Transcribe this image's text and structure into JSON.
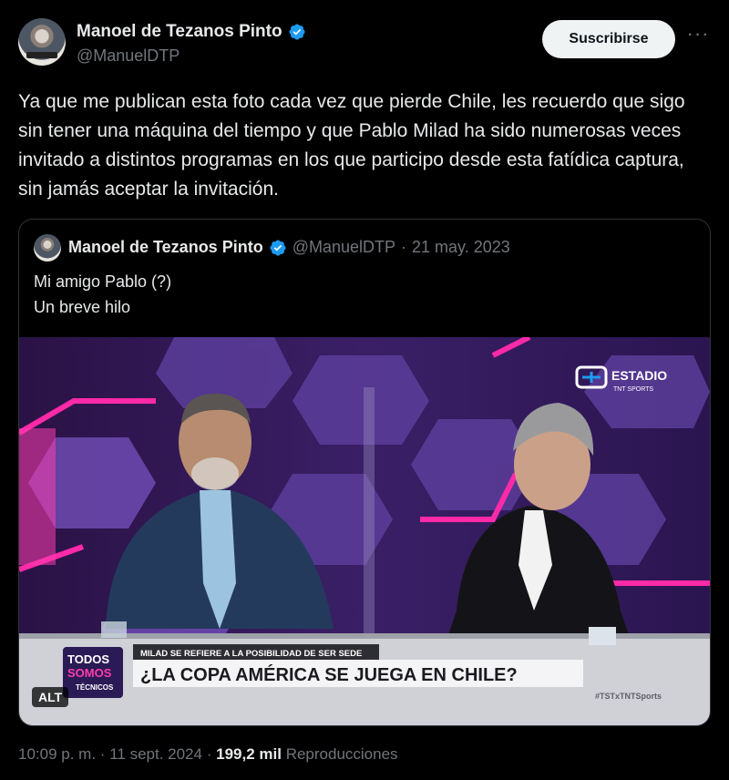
{
  "author": {
    "name": "Manoel de Tezanos Pinto",
    "handle": "@ManuelDTP"
  },
  "actions": {
    "subscribe_label": "Suscribirse",
    "more_label": "···"
  },
  "tweet": {
    "text": "Ya que me publican esta foto cada vez que pierde Chile, les recuerdo que sigo sin tener una máquina del tiempo y que Pablo Milad ha sido numerosas veces invitado a distintos programas en los que participo desde esta fatídica captura, sin jamás aceptar la invitación."
  },
  "quoted": {
    "name": "Manoel de Tezanos Pinto",
    "handle": "@ManuelDTP",
    "separator": "·",
    "date": "21 may. 2023",
    "text_line1": "Mi amigo Pablo (?)",
    "text_line2": "Un breve hilo",
    "media": {
      "alt_badge": "ALT",
      "channel_logo": "ESTADIO",
      "channel_sub": "TNT SPORTS",
      "lower_third_small": "MILAD SE REFIERE A LA POSIBILIDAD DE SER SEDE",
      "lower_third_big": "¿LA COPA AMÉRICA SE JUEGA EN CHILE?",
      "hashtag": "#TSTxTNTSports",
      "program_logo_1": "TODOS",
      "program_logo_2": "SOMOS",
      "program_logo_3": "TÉCNICOS",
      "mic_flag_text": "TNT SPORTS"
    }
  },
  "footer": {
    "time": "10:09 p. m.",
    "dot1": "·",
    "date": "11 sept. 2024",
    "dot2": "·",
    "views_count": "199,2 mil",
    "views_label": "Reproducciones"
  },
  "colors": {
    "verified": "#1d9bf0",
    "background": "#000000",
    "text_primary": "#e7e9ea",
    "text_secondary": "#71767b"
  }
}
